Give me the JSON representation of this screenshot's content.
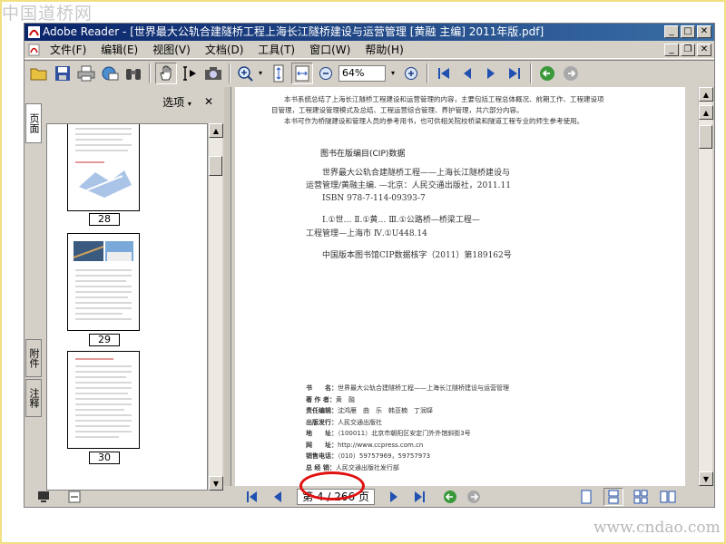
{
  "watermark_top": "中国道桥网",
  "watermark_bottom": "www.cndao.com",
  "window": {
    "title": "Adobe Reader - [世界最大公轨合建隧桥工程上海长江隧桥建设与运营管理 [黄融 主编] 2011年版.pdf]"
  },
  "menu": [
    {
      "label": "文件(F)"
    },
    {
      "label": "编辑(E)"
    },
    {
      "label": "视图(V)"
    },
    {
      "label": "文档(D)"
    },
    {
      "label": "工具(T)"
    },
    {
      "label": "窗口(W)"
    },
    {
      "label": "帮助(H)"
    }
  ],
  "toolbar": {
    "zoom": "64%"
  },
  "panel": {
    "options_label": "选项",
    "close_label": "✕",
    "tabs": [
      {
        "label": "页面"
      },
      {
        "label": "附件"
      },
      {
        "label": "注释"
      }
    ],
    "thumbnails": [
      {
        "page": "28"
      },
      {
        "page": "29"
      },
      {
        "page": "30"
      }
    ]
  },
  "document": {
    "intro_lines": [
      "本书系统总结了上海长江隧桥工程建设和运营管理的内容，主要包括工程总体概况、前期工作、工程建设项",
      "目管理，工程建设管理模式及总结、工程运营综合管理、养护管理，共六部分内容。",
      "本书可作为桥隧建设和管理人员的参考用书，也可供相关院校桥梁和隧道工程专业的师生参考使用。"
    ],
    "cip_heading": "图书在版编目(CIP)数据",
    "cip_lines": [
      "世界最大公轨合建隧桥工程——上海长江隧桥建设与",
      "运营管理/黄融主编. —北京：人民交通出版社，2011.11",
      "ISBN 978-7-114-09393-7"
    ],
    "class_lines": [
      "Ⅰ.①世… Ⅱ.①黄… Ⅲ.①公路桥—桥梁工程—",
      "工程管理—上海市 Ⅳ.①U448.14"
    ],
    "cip_number": "中国版本图书馆CIP数据核字（2011）第189162号",
    "biblio": [
      {
        "label": "书　　名：",
        "value": "世界最大公轨合建隧桥工程——上海长江隧桥建设与运营管理"
      },
      {
        "label": "著 作 者：",
        "value": "黄　融"
      },
      {
        "label": "责任编辑：",
        "value": "沈鸿雁　曲　乐　韩亚楠　丁润铎"
      },
      {
        "label": "出版发行：",
        "value": "人民交通出版社"
      },
      {
        "label": "地　　址：",
        "value": "（100011）北京市朝阳区安定门外外馆斜街3号"
      },
      {
        "label": "网　　址：",
        "value": "http://www.ccpress.com.cn"
      },
      {
        "label": "销售电话：",
        "value": "（010）59757969，59757973"
      },
      {
        "label": "总 经 销：",
        "value": "人民交通出版社发行部"
      }
    ]
  },
  "status": {
    "page_indicator": "第 4 / 266 页"
  },
  "colors": {
    "titlebar": "#0a246a",
    "highlight_oval": "#e01010",
    "chrome": "#d4d0c8"
  }
}
